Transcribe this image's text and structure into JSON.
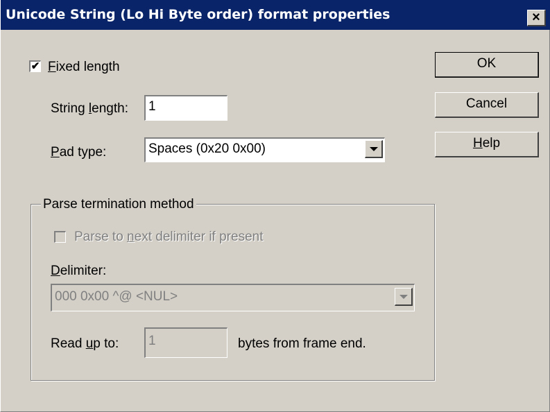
{
  "window": {
    "title": "Unicode String (Lo Hi Byte order) format properties",
    "close_glyph": "×"
  },
  "fixed_length": {
    "checked_glyph": "✔",
    "label_access": "F",
    "label_rest": "ixed length"
  },
  "string_length": {
    "label_pre": "String ",
    "label_access": "l",
    "label_rest": "ength:",
    "value": "1"
  },
  "pad_type": {
    "label_access": "P",
    "label_rest": "ad type:",
    "value": "Spaces (0x20 0x00)"
  },
  "buttons": {
    "ok": "OK",
    "cancel": "Cancel",
    "help_access": "H",
    "help_rest": "elp"
  },
  "parse_group": {
    "title": "Parse termination method",
    "parse_next_pre": "Parse to ",
    "parse_next_access": "n",
    "parse_next_rest": "ext delimiter if present",
    "delimiter_label_access": "D",
    "delimiter_label_rest": "elimiter:",
    "delimiter_value": "000   0x00   ^@   <NUL>",
    "read_up_to_pre": "Read ",
    "read_up_to_access": "u",
    "read_up_to_rest": "p to:",
    "read_up_to_value": "1",
    "bytes_suffix": "bytes from frame end."
  },
  "colors": {
    "face": "#d4d0c8",
    "titlebar": "#0a246a",
    "disabled_text": "#808080"
  }
}
